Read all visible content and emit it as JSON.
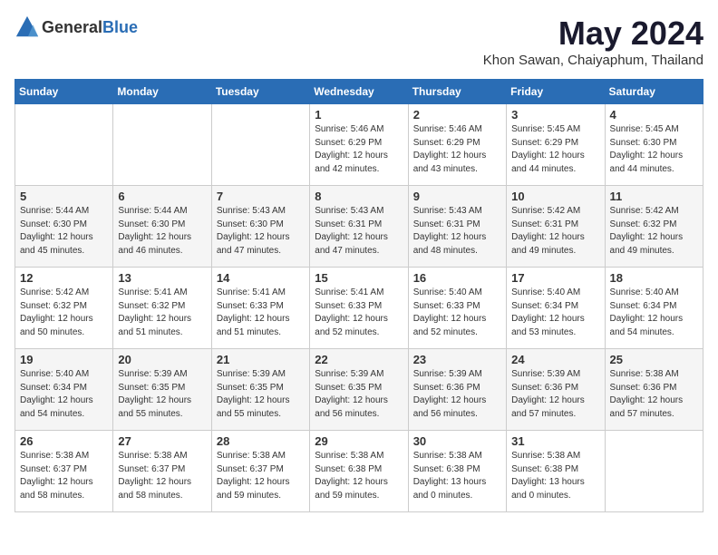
{
  "logo": {
    "text_general": "General",
    "text_blue": "Blue"
  },
  "header": {
    "month": "May 2024",
    "location": "Khon Sawan, Chaiyaphum, Thailand"
  },
  "days_of_week": [
    "Sunday",
    "Monday",
    "Tuesday",
    "Wednesday",
    "Thursday",
    "Friday",
    "Saturday"
  ],
  "weeks": [
    {
      "cells": [
        {
          "day": "",
          "info": ""
        },
        {
          "day": "",
          "info": ""
        },
        {
          "day": "",
          "info": ""
        },
        {
          "day": "1",
          "info": "Sunrise: 5:46 AM\nSunset: 6:29 PM\nDaylight: 12 hours\nand 42 minutes."
        },
        {
          "day": "2",
          "info": "Sunrise: 5:46 AM\nSunset: 6:29 PM\nDaylight: 12 hours\nand 43 minutes."
        },
        {
          "day": "3",
          "info": "Sunrise: 5:45 AM\nSunset: 6:29 PM\nDaylight: 12 hours\nand 44 minutes."
        },
        {
          "day": "4",
          "info": "Sunrise: 5:45 AM\nSunset: 6:30 PM\nDaylight: 12 hours\nand 44 minutes."
        }
      ]
    },
    {
      "cells": [
        {
          "day": "5",
          "info": "Sunrise: 5:44 AM\nSunset: 6:30 PM\nDaylight: 12 hours\nand 45 minutes."
        },
        {
          "day": "6",
          "info": "Sunrise: 5:44 AM\nSunset: 6:30 PM\nDaylight: 12 hours\nand 46 minutes."
        },
        {
          "day": "7",
          "info": "Sunrise: 5:43 AM\nSunset: 6:30 PM\nDaylight: 12 hours\nand 47 minutes."
        },
        {
          "day": "8",
          "info": "Sunrise: 5:43 AM\nSunset: 6:31 PM\nDaylight: 12 hours\nand 47 minutes."
        },
        {
          "day": "9",
          "info": "Sunrise: 5:43 AM\nSunset: 6:31 PM\nDaylight: 12 hours\nand 48 minutes."
        },
        {
          "day": "10",
          "info": "Sunrise: 5:42 AM\nSunset: 6:31 PM\nDaylight: 12 hours\nand 49 minutes."
        },
        {
          "day": "11",
          "info": "Sunrise: 5:42 AM\nSunset: 6:32 PM\nDaylight: 12 hours\nand 49 minutes."
        }
      ]
    },
    {
      "cells": [
        {
          "day": "12",
          "info": "Sunrise: 5:42 AM\nSunset: 6:32 PM\nDaylight: 12 hours\nand 50 minutes."
        },
        {
          "day": "13",
          "info": "Sunrise: 5:41 AM\nSunset: 6:32 PM\nDaylight: 12 hours\nand 51 minutes."
        },
        {
          "day": "14",
          "info": "Sunrise: 5:41 AM\nSunset: 6:33 PM\nDaylight: 12 hours\nand 51 minutes."
        },
        {
          "day": "15",
          "info": "Sunrise: 5:41 AM\nSunset: 6:33 PM\nDaylight: 12 hours\nand 52 minutes."
        },
        {
          "day": "16",
          "info": "Sunrise: 5:40 AM\nSunset: 6:33 PM\nDaylight: 12 hours\nand 52 minutes."
        },
        {
          "day": "17",
          "info": "Sunrise: 5:40 AM\nSunset: 6:34 PM\nDaylight: 12 hours\nand 53 minutes."
        },
        {
          "day": "18",
          "info": "Sunrise: 5:40 AM\nSunset: 6:34 PM\nDaylight: 12 hours\nand 54 minutes."
        }
      ]
    },
    {
      "cells": [
        {
          "day": "19",
          "info": "Sunrise: 5:40 AM\nSunset: 6:34 PM\nDaylight: 12 hours\nand 54 minutes."
        },
        {
          "day": "20",
          "info": "Sunrise: 5:39 AM\nSunset: 6:35 PM\nDaylight: 12 hours\nand 55 minutes."
        },
        {
          "day": "21",
          "info": "Sunrise: 5:39 AM\nSunset: 6:35 PM\nDaylight: 12 hours\nand 55 minutes."
        },
        {
          "day": "22",
          "info": "Sunrise: 5:39 AM\nSunset: 6:35 PM\nDaylight: 12 hours\nand 56 minutes."
        },
        {
          "day": "23",
          "info": "Sunrise: 5:39 AM\nSunset: 6:36 PM\nDaylight: 12 hours\nand 56 minutes."
        },
        {
          "day": "24",
          "info": "Sunrise: 5:39 AM\nSunset: 6:36 PM\nDaylight: 12 hours\nand 57 minutes."
        },
        {
          "day": "25",
          "info": "Sunrise: 5:38 AM\nSunset: 6:36 PM\nDaylight: 12 hours\nand 57 minutes."
        }
      ]
    },
    {
      "cells": [
        {
          "day": "26",
          "info": "Sunrise: 5:38 AM\nSunset: 6:37 PM\nDaylight: 12 hours\nand 58 minutes."
        },
        {
          "day": "27",
          "info": "Sunrise: 5:38 AM\nSunset: 6:37 PM\nDaylight: 12 hours\nand 58 minutes."
        },
        {
          "day": "28",
          "info": "Sunrise: 5:38 AM\nSunset: 6:37 PM\nDaylight: 12 hours\nand 59 minutes."
        },
        {
          "day": "29",
          "info": "Sunrise: 5:38 AM\nSunset: 6:38 PM\nDaylight: 12 hours\nand 59 minutes."
        },
        {
          "day": "30",
          "info": "Sunrise: 5:38 AM\nSunset: 6:38 PM\nDaylight: 13 hours\nand 0 minutes."
        },
        {
          "day": "31",
          "info": "Sunrise: 5:38 AM\nSunset: 6:38 PM\nDaylight: 13 hours\nand 0 minutes."
        },
        {
          "day": "",
          "info": ""
        }
      ]
    }
  ]
}
